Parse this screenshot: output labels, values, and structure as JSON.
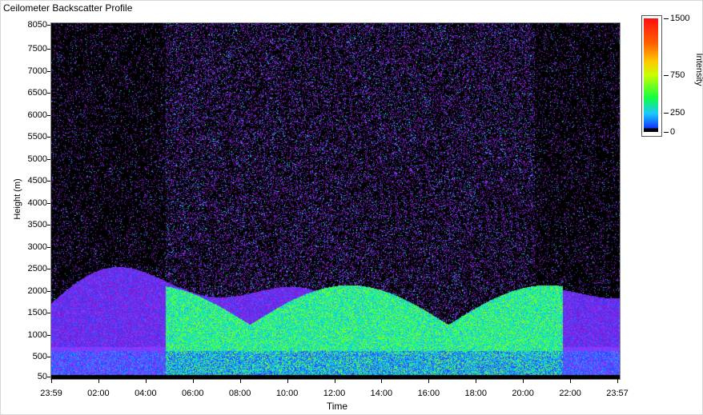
{
  "window": {
    "title": "Ceilometer Backscatter Profile"
  },
  "chart_data": {
    "type": "heatmap",
    "title": "Ceilometer Backscatter Profile",
    "xlabel": "Time",
    "ylabel": "Height (m)",
    "x_ticks": [
      "23:59",
      "02:00",
      "04:00",
      "06:00",
      "08:00",
      "10:00",
      "12:00",
      "14:00",
      "16:00",
      "18:00",
      "20:00",
      "22:00",
      "23:57"
    ],
    "y_ticks": [
      50,
      500,
      1000,
      1500,
      2000,
      2500,
      3000,
      3500,
      4000,
      4500,
      5000,
      5500,
      6000,
      6500,
      7000,
      7500,
      8050
    ],
    "ylim": [
      50,
      8050
    ],
    "colorbar": {
      "label": "Intensity",
      "ticks": [
        0,
        250,
        750,
        1500
      ],
      "range": [
        0,
        1500
      ]
    },
    "colors": {
      "low": "#000000",
      "noise": "#8a2be2",
      "mid": "#18c8ff",
      "high": "#10ff40",
      "peak": "#ff1010"
    }
  }
}
